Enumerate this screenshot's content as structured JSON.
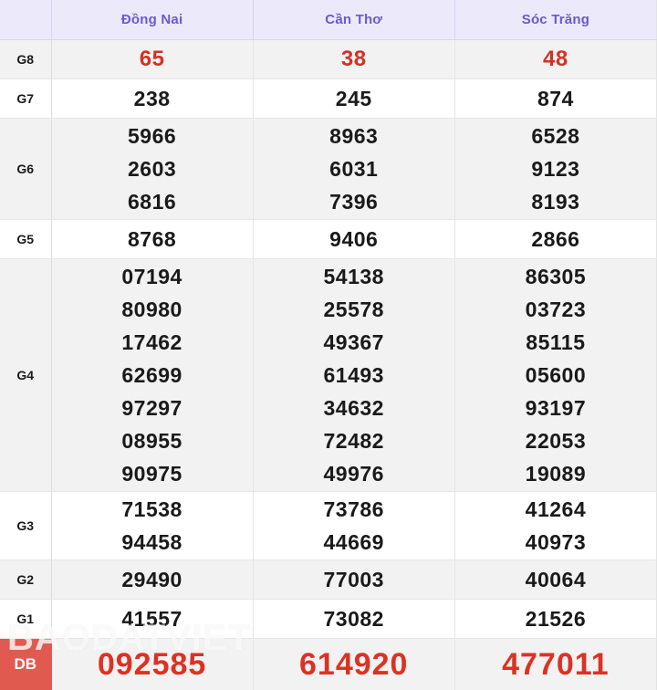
{
  "table": {
    "corner_label": "",
    "provinces": [
      "Đồng Nai",
      "Cần Thơ",
      "Sóc Trăng"
    ],
    "header_color": "#6a5acd",
    "header_bg": "#ece9fb",
    "highlight_color": "#d13226",
    "db_label_bg": "#e05a50",
    "rows": [
      {
        "label": "G8",
        "values": [
          [
            "65"
          ],
          [
            "38"
          ],
          [
            "48"
          ]
        ]
      },
      {
        "label": "G7",
        "values": [
          [
            "238"
          ],
          [
            "245"
          ],
          [
            "874"
          ]
        ]
      },
      {
        "label": "G6",
        "values": [
          [
            "5966",
            "2603",
            "6816"
          ],
          [
            "8963",
            "6031",
            "7396"
          ],
          [
            "6528",
            "9123",
            "8193"
          ]
        ]
      },
      {
        "label": "G5",
        "values": [
          [
            "8768"
          ],
          [
            "9406"
          ],
          [
            "2866"
          ]
        ]
      },
      {
        "label": "G4",
        "values": [
          [
            "07194",
            "80980",
            "17462",
            "62699",
            "97297",
            "08955",
            "90975"
          ],
          [
            "54138",
            "25578",
            "49367",
            "61493",
            "34632",
            "72482",
            "49976"
          ],
          [
            "86305",
            "03723",
            "85115",
            "05600",
            "93197",
            "22053",
            "19089"
          ]
        ]
      },
      {
        "label": "G3",
        "values": [
          [
            "71538",
            "94458"
          ],
          [
            "73786",
            "44669"
          ],
          [
            "41264",
            "40973"
          ]
        ]
      },
      {
        "label": "G2",
        "values": [
          [
            "29490"
          ],
          [
            "77003"
          ],
          [
            "40064"
          ]
        ]
      },
      {
        "label": "G1",
        "values": [
          [
            "41557"
          ],
          [
            "73082"
          ],
          [
            "21526"
          ]
        ]
      },
      {
        "label": "DB",
        "values": [
          [
            "092585"
          ],
          [
            "614920"
          ],
          [
            "477011"
          ]
        ]
      }
    ]
  },
  "watermark": {
    "text": "BAODATVIET"
  }
}
